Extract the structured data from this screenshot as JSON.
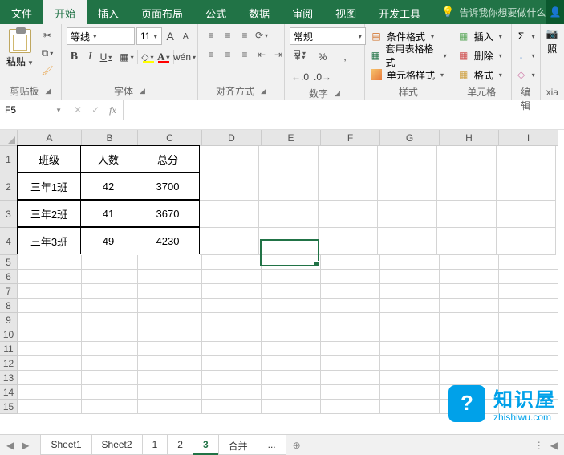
{
  "tabs": {
    "file": "文件",
    "home": "开始",
    "insert": "插入",
    "layout": "页面布局",
    "formulas": "公式",
    "data": "数据",
    "review": "审阅",
    "view": "视图",
    "dev": "开发工具"
  },
  "tellme": "告诉我你想要做什么",
  "ribbon": {
    "clipboard": {
      "label": "剪贴板",
      "paste": "粘贴"
    },
    "font": {
      "label": "字体",
      "name": "等线",
      "size": "11",
      "aplus": "A",
      "aminus": "A",
      "bold": "B",
      "italic": "I",
      "underline": "U",
      "wen": "wén"
    },
    "align": {
      "label": "对齐方式",
      "wrap": "㏗",
      "merge": "⬌"
    },
    "number": {
      "label": "数字",
      "format": "常规",
      "currency": "¥",
      "percent": "%",
      "comma": ",",
      "inc": ".0←.00",
      "dec": ".00→.0"
    },
    "styles": {
      "label": "样式",
      "cond": "条件格式",
      "table": "套用表格格式",
      "cell": "单元格样式"
    },
    "cells": {
      "label": "单元格",
      "insert": "插入",
      "delete": "删除",
      "format": "格式"
    },
    "editing": {
      "label": "编辑"
    },
    "xia": {
      "label": "xia",
      "btn": "照"
    }
  },
  "namebox": "F5",
  "fx": "fx",
  "columns": [
    "A",
    "B",
    "C",
    "D",
    "E",
    "F",
    "G",
    "H",
    "I"
  ],
  "rows": [
    "1",
    "2",
    "3",
    "4",
    "5",
    "6",
    "7",
    "8",
    "9",
    "10",
    "11",
    "12",
    "13",
    "14",
    "15"
  ],
  "chart_data": {
    "type": "table",
    "headers": {
      "class": "班级",
      "count": "人数",
      "total": "总分"
    },
    "rows": [
      {
        "class": "三年1班",
        "count": "42",
        "total": "3700"
      },
      {
        "class": "三年2班",
        "count": "41",
        "total": "3670"
      },
      {
        "class": "三年3班",
        "count": "49",
        "total": "4230"
      }
    ]
  },
  "sheets": {
    "s1": "Sheet1",
    "s2": "Sheet2",
    "t1": "1",
    "t2": "2",
    "t3": "3",
    "merge": "合并"
  },
  "dots": "...",
  "plus": "⊕",
  "watermark": {
    "title": "知识屋",
    "url": "zhishiwu.com",
    "q": "?"
  }
}
